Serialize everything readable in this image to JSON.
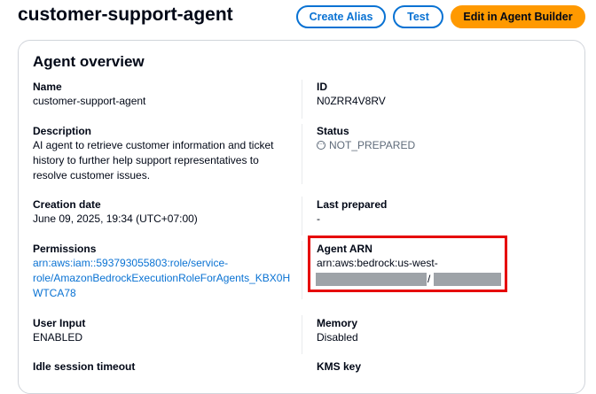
{
  "header": {
    "title": "customer-support-agent",
    "create_alias_label": "Create Alias",
    "test_label": "Test",
    "edit_label": "Edit in Agent Builder"
  },
  "overview": {
    "title": "Agent overview",
    "name_label": "Name",
    "name_value": "customer-support-agent",
    "id_label": "ID",
    "id_value": "N0ZRR4V8RV",
    "description_label": "Description",
    "description_lines": [
      "AI agent to retrieve customer information and ticket",
      "history to further help support representatives to",
      "resolve customer issues."
    ],
    "status_label": "Status",
    "status_value": "NOT_PREPARED",
    "creation_label": "Creation date",
    "creation_value": "June 09, 2025, 19:34 (UTC+07:00)",
    "last_prepared_label": "Last prepared",
    "last_prepared_value": "-",
    "permissions_label": "Permissions",
    "permissions_lines": [
      "arn:aws:iam::593793055803:role/service-",
      "role/AmazonBedrockExecutionRoleForAgents_KBX0H",
      "WTCA78"
    ],
    "arn_label": "Agent ARN",
    "arn_value": "arn:aws:bedrock:us-west-",
    "arn_separator": "/",
    "user_input_label": "User Input",
    "user_input_value": "ENABLED",
    "memory_label": "Memory",
    "memory_value": "Disabled",
    "idle_label": "Idle session timeout",
    "kms_label": "KMS key"
  },
  "colors": {
    "link": "#0972d3",
    "primary": "#ff9900",
    "highlight": "#e60000",
    "redaction": "#9ea3a8"
  },
  "icons": {
    "status": "not-prepared-status-icon"
  }
}
